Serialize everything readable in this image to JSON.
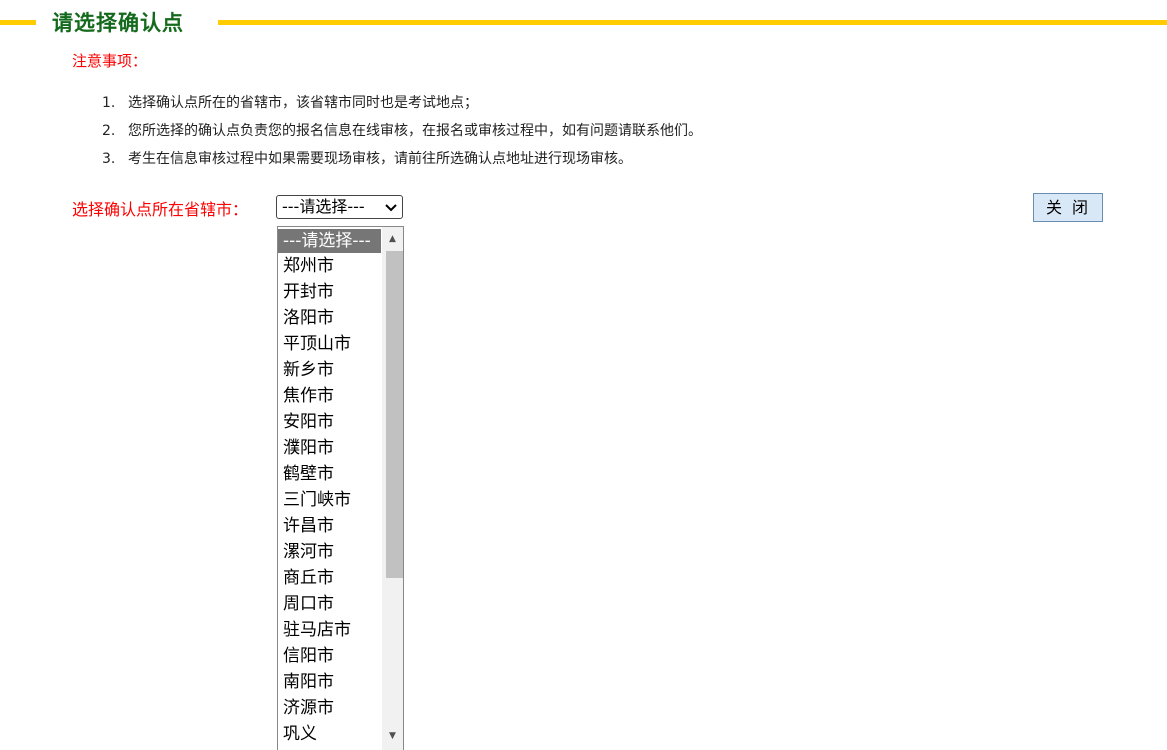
{
  "header": {
    "title": "请选择确认点",
    "accent_color": "#ffcc00",
    "title_color": "#146a1c"
  },
  "notice": {
    "title": "注意事项：",
    "items": [
      {
        "num": "1.",
        "text": "选择确认点所在的省辖市，该省辖市同时也是考试地点；"
      },
      {
        "num": "2.",
        "text": "您所选择的确认点负责您的报名信息在线审核，在报名或审核过程中，如有问题请联系他们。"
      },
      {
        "num": "3.",
        "text": "考生在信息审核过程中如果需要现场审核，请前往所选确认点地址进行现场审核。"
      }
    ]
  },
  "form": {
    "label": "选择确认点所在省辖市：",
    "selected": "---请选择---",
    "chevron_icon": "chevron-down-icon",
    "options": [
      "---请选择---",
      "郑州市",
      "开封市",
      "洛阳市",
      "平顶山市",
      "新乡市",
      "焦作市",
      "安阳市",
      "濮阳市",
      "鹤壁市",
      "三门峡市",
      "许昌市",
      "漯河市",
      "商丘市",
      "周口市",
      "驻马店市",
      "信阳市",
      "南阳市",
      "济源市",
      "巩义"
    ]
  },
  "close_button": {
    "label": "关闭"
  }
}
